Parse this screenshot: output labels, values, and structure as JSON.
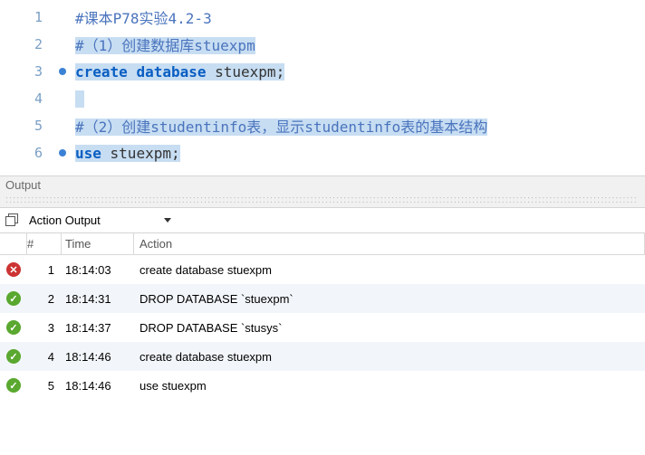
{
  "editor": {
    "lines": [
      {
        "num": "1",
        "bp": false,
        "sel": false,
        "tokens": [
          {
            "t": "cmt",
            "v": "#课本P78实验4.2-3"
          }
        ]
      },
      {
        "num": "2",
        "bp": false,
        "sel": true,
        "tokens": [
          {
            "t": "cmt",
            "v": "#（1）创建数据库stuexpm"
          }
        ]
      },
      {
        "num": "3",
        "bp": true,
        "sel": true,
        "tokens": [
          {
            "t": "kw",
            "v": "create"
          },
          {
            "t": "plain",
            "v": " "
          },
          {
            "t": "kw",
            "v": "database"
          },
          {
            "t": "plain",
            "v": " stuexpm;"
          }
        ]
      },
      {
        "num": "4",
        "bp": false,
        "sel": true,
        "tokens": [
          {
            "t": "plain",
            "v": " "
          }
        ]
      },
      {
        "num": "5",
        "bp": false,
        "sel": true,
        "tokens": [
          {
            "t": "cmt",
            "v": "#（2）创建studentinfo表，显示studentinfo表的基本结构"
          }
        ]
      },
      {
        "num": "6",
        "bp": true,
        "sel": true,
        "tokens": [
          {
            "t": "kw",
            "v": "use"
          },
          {
            "t": "plain",
            "v": " stuexpm;"
          }
        ]
      }
    ]
  },
  "output": {
    "title": "Output",
    "selector": "Action Output",
    "columns": {
      "num": "#",
      "time": "Time",
      "action": "Action"
    },
    "rows": [
      {
        "status": "err",
        "num": "1",
        "time": "18:14:03",
        "action": "create database stuexpm"
      },
      {
        "status": "ok",
        "num": "2",
        "time": "18:14:31",
        "action": "DROP DATABASE `stuexpm`"
      },
      {
        "status": "ok",
        "num": "3",
        "time": "18:14:37",
        "action": "DROP DATABASE `stusys`"
      },
      {
        "status": "ok",
        "num": "4",
        "time": "18:14:46",
        "action": "create database stuexpm"
      },
      {
        "status": "ok",
        "num": "5",
        "time": "18:14:46",
        "action": "use stuexpm"
      }
    ]
  },
  "glyphs": {
    "ok": "✓",
    "err": "✕"
  }
}
